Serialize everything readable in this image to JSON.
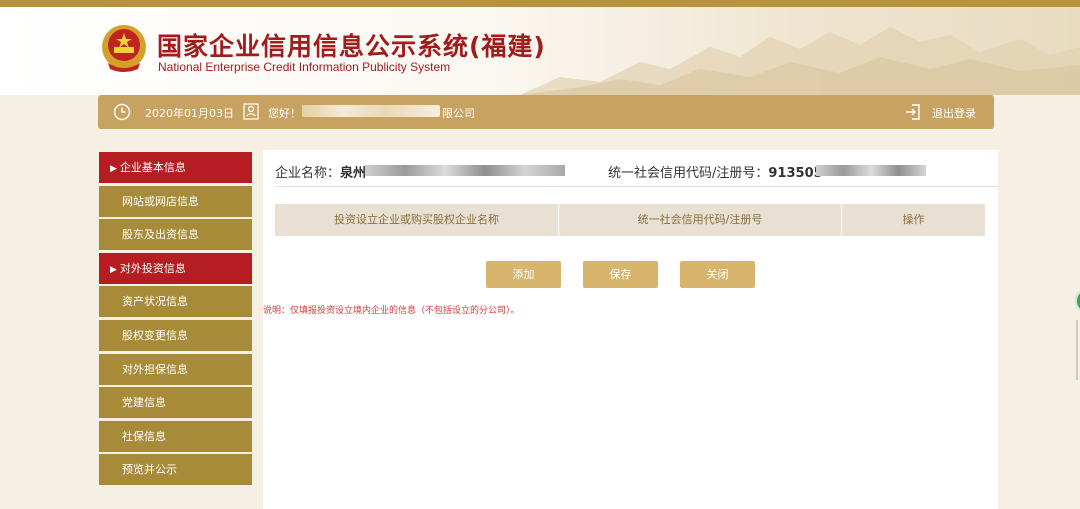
{
  "header": {
    "title_cn": "国家企业信用信息公示系统(福建)",
    "title_en": "National Enterprise Credit Information Publicity System"
  },
  "infobar": {
    "date": "2020年01月03日",
    "greeting": "您好！",
    "company_suffix": "限公司",
    "logout": "退出登录"
  },
  "sidebar": {
    "items": [
      {
        "label": "企业基本信息",
        "active": true
      },
      {
        "label": "网站或网店信息",
        "active": false
      },
      {
        "label": "股东及出资信息",
        "active": false
      },
      {
        "label": "对外投资信息",
        "active": true
      },
      {
        "label": "资产状况信息",
        "active": false
      },
      {
        "label": "股权变更信息",
        "active": false
      },
      {
        "label": "对外担保信息",
        "active": false
      },
      {
        "label": "党建信息",
        "active": false
      },
      {
        "label": "社保信息",
        "active": false
      },
      {
        "label": "预览并公示",
        "active": false
      }
    ]
  },
  "main": {
    "company_label": "企业名称：",
    "company_value": "泉州",
    "code_label": "统一社会信用代码/注册号：",
    "code_value": "913505",
    "table": {
      "headers": [
        "投资设立企业或购买股权企业名称",
        "统一社会信用代码/注册号",
        "操作"
      ]
    },
    "buttons": {
      "add": "添加",
      "save": "保存",
      "close": "关闭"
    },
    "note": "说明：仅填报投资设立境内企业的信息（不包括设立的分公司）。"
  },
  "colors": {
    "accent_gold": "#c8a261",
    "sidebar_gold": "#a88b39",
    "active_red": "#b51d22",
    "title_red": "#a31c1c",
    "note_red": "#d23a3a"
  }
}
